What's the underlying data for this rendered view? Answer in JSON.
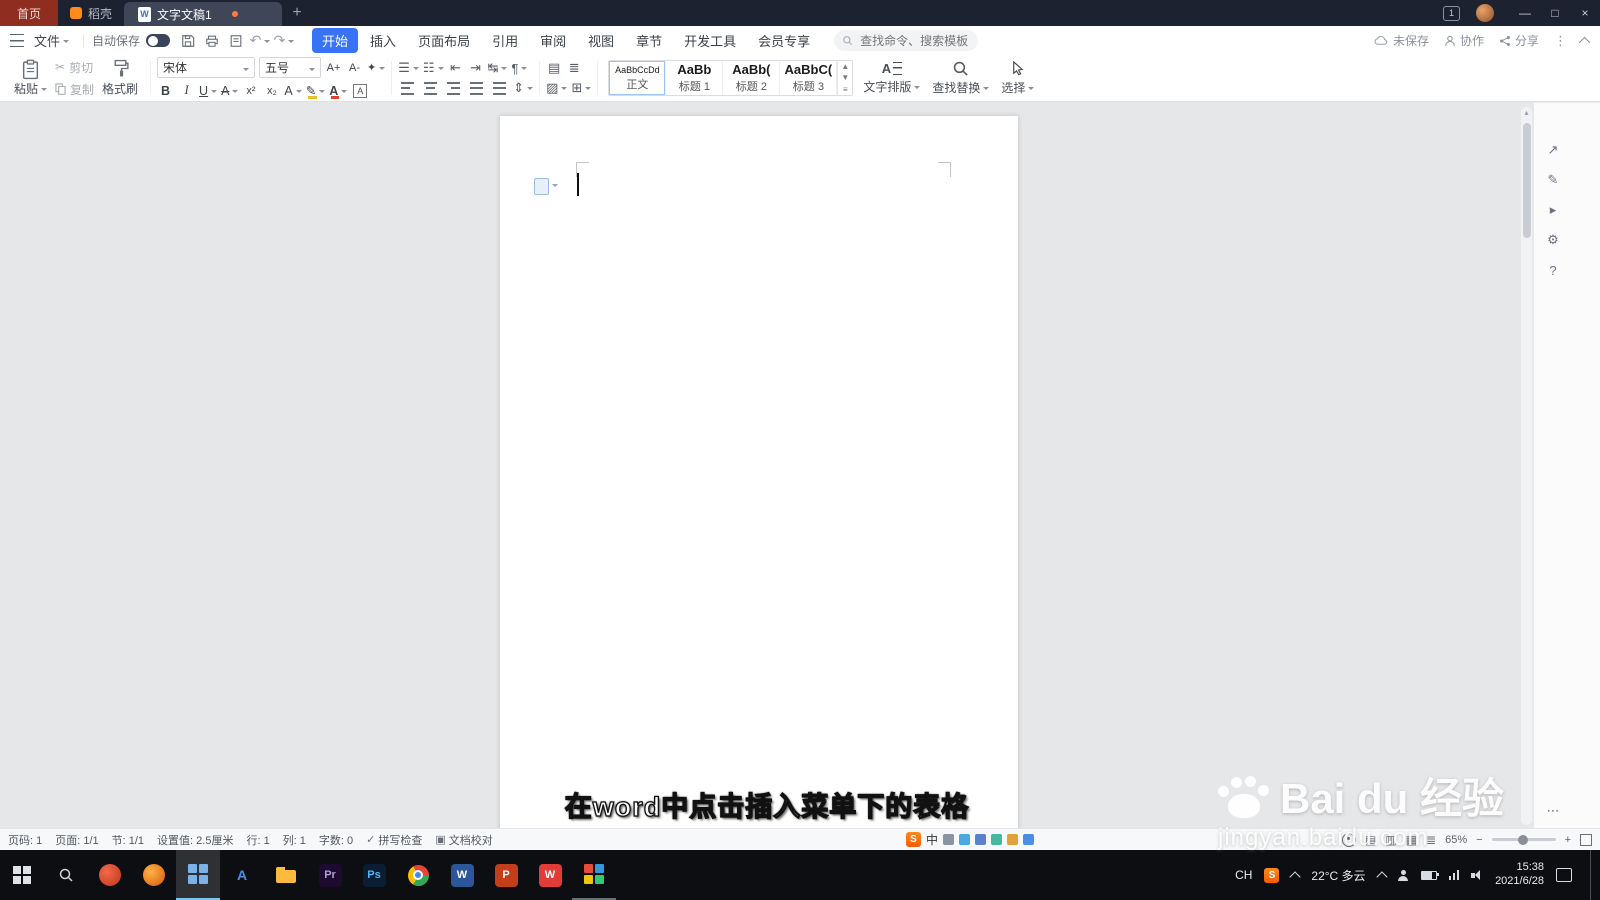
{
  "titlebar": {
    "home": "首页",
    "docer": "稻壳",
    "doc": "文字文稿1",
    "split_badge": "1",
    "writer_glyph": "W"
  },
  "menubar": {
    "file": "文件",
    "autosave": "自动保存",
    "tabs": [
      "开始",
      "插入",
      "页面布局",
      "引用",
      "审阅",
      "视图",
      "章节",
      "开发工具",
      "会员专享"
    ],
    "search_placeholder": "查找命令、搜索模板",
    "unsaved": "未保存",
    "collab": "协作",
    "share": "分享"
  },
  "ribbon": {
    "paste": "粘贴",
    "cut": "剪切",
    "copy": "复制",
    "painter": "格式刷",
    "font_name": "宋体",
    "font_size": "五号",
    "grow": "A+",
    "shrink": "A-",
    "effects": "✦",
    "bold": "B",
    "italic": "I",
    "underline": "U",
    "strike": "A",
    "sup": "x²",
    "sub": "x₂",
    "pinyin": "A",
    "highlight": "✎",
    "fontcolor": "A",
    "boxed": "A",
    "bullets": "☰",
    "numbering": "☷",
    "outdent": "⇤",
    "indent": "⇥",
    "swap": "↹",
    "pilcrow": "¶",
    "linespace": "⇕",
    "shade_a": "▤",
    "shade_b": "≣",
    "fill": "▨",
    "borders": "⊞",
    "styles": [
      {
        "preview": "AaBbCcDd",
        "name": "正文"
      },
      {
        "preview": "AaBb",
        "name": "标题 1"
      },
      {
        "preview": "AaBb(",
        "name": "标题 2"
      },
      {
        "preview": "AaBbC(",
        "name": "标题 3"
      }
    ],
    "text_layout": "文字排版",
    "tl_glyph": "A",
    "find": "查找替换",
    "select": "选择"
  },
  "document": {
    "caption": "在word中点击插入菜单下的表格"
  },
  "watermark": {
    "brand": "Bai du 经验",
    "url": "jingyan.baidu.com"
  },
  "statusbar": {
    "page_no": "页码: 1",
    "page": "页面: 1/1",
    "section": "节: 1/1",
    "setting": "设置值: 2.5厘米",
    "line": "行: 1",
    "col": "列: 1",
    "words": "字数: 0",
    "spell": "拼写检查",
    "proof": "文档校对",
    "zoom": "65%",
    "views": [
      "▤",
      "▥",
      "▦",
      "≣"
    ]
  },
  "ime": {
    "badge": "S",
    "lang": "中"
  },
  "taskbar": {
    "lang": "CH",
    "sogou": "S",
    "weather": "22°C 多云",
    "time": "15:38",
    "date": "2021/6/28",
    "app_a": "A",
    "app_pr": "Pr",
    "app_ps": "Ps",
    "app_word": "W",
    "app_ppt": "P",
    "app_wps": "W"
  },
  "icons": {
    "minimize": "—",
    "maximize": "□",
    "close": "×",
    "new_tab": "+",
    "undo": "↶",
    "redo": "↷",
    "cut": "✂",
    "more_v": "⋮",
    "check": "✓",
    "proof_box": "▣",
    "scroll_up": "▴",
    "minus": "−",
    "plus": "+",
    "sidebar": [
      "↗",
      "✎",
      "▸",
      "⚙",
      "?",
      "⋯"
    ]
  }
}
